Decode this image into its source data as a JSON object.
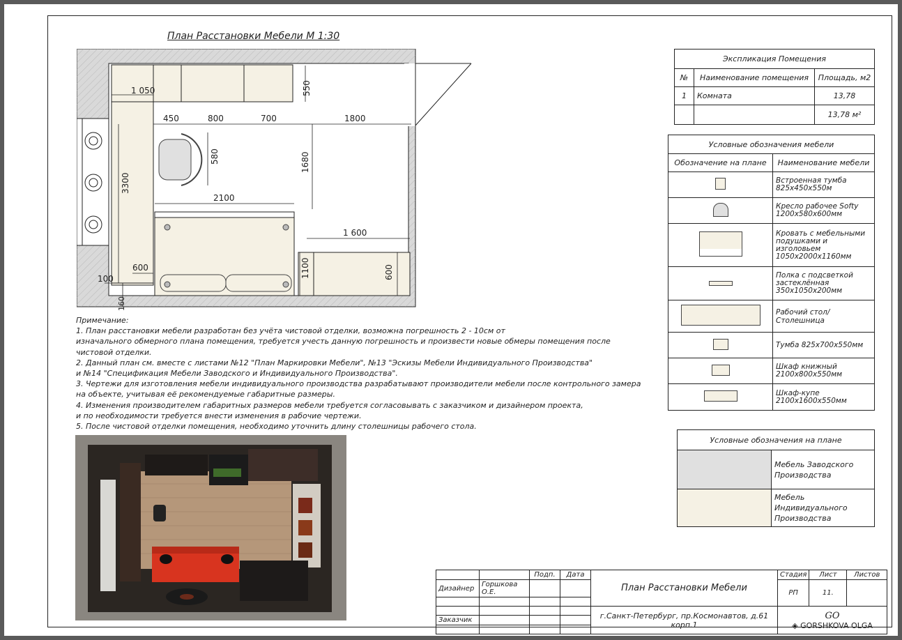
{
  "plan_title": "План Расстановки Мебели    М 1:30",
  "dimensions": {
    "d1050": "1 050",
    "d550": "550",
    "d450": "450",
    "d800": "800",
    "d700": "700",
    "d1800": "1800",
    "d3300": "3300",
    "d580": "580",
    "d1680": "1680",
    "d2100": "2100",
    "d1600": "1 600",
    "d600a": "600",
    "d1100": "1100",
    "d600b": "600",
    "d100": "100",
    "d160": "160"
  },
  "explication": {
    "title": "Экспликация Помещения",
    "col_no": "№",
    "col_name": "Наименование помещения",
    "col_area": "Площадь, м2",
    "rows": [
      {
        "no": "1",
        "name": "Комната",
        "area": "13,78"
      }
    ],
    "total": "13,78 м²"
  },
  "furniture_legend": {
    "title": "Условные обозначения мебели",
    "col_symbol": "Обозначение на плане",
    "col_name": "Наименование мебели",
    "items": [
      {
        "icon": "nightstand-icon",
        "name": "Встроенная тумба 825х450х550м"
      },
      {
        "icon": "armchair-icon",
        "name": "Кресло рабочее Softy 1200х580х600мм"
      },
      {
        "icon": "bed-icon",
        "name": "Кровать с мебельными подушками и изголовьем 1050х2000х1160мм"
      },
      {
        "icon": "shelf-icon",
        "name": "Полка с подсветкой застеклённая 350х1050х200мм"
      },
      {
        "icon": "desk-icon",
        "name": "Рабочий стол/Столешница"
      },
      {
        "icon": "cabinet-icon",
        "name": "Тумба 825х700х550мм"
      },
      {
        "icon": "bookcase-icon",
        "name": "Шкаф книжный 2100х800х550мм"
      },
      {
        "icon": "wardrobe-icon",
        "name": "Шкаф-купе 2100х1600х550мм"
      }
    ]
  },
  "plan_legend": {
    "title": "Условные обозначения на плане",
    "factory": "Мебель Заводского Производства",
    "custom": "Мебель Индивидуального Производства",
    "factory_color": "#e0e0e0",
    "custom_color": "#f5f1e4"
  },
  "notes": {
    "heading": "Примечание:",
    "lines": [
      "1. План расстановки мебели разработан без учёта чистовой отделки, возможна погрешность 2 - 10см от",
      "изначального обмерного плана помещения, требуется учесть данную погрешность и произвести новые обмеры помещения после",
      "чистовой отделки.",
      "2. Данный план см. вместе с листами №12 \"План Маркировки Мебели\", №13 \"Эскизы Мебели Индивидуального Производства\"",
      "и №14 \"Спецификация Мебели Заводского и Индивидуального Производства\".",
      "3. Чертежи для изготовления мебели индивидуального производства разрабатывают производители мебели после контрольного замера",
      "на объекте, учитывая её рекомендуемые габаритные размеры.",
      "4. Изменения производителем габаритных размеров мебели требуется согласовывать с заказчиком и дизайнером проекта,",
      "и по необходимости требуется внести изменения в рабочие чертежи.",
      "5. После чистовой отделки помещения, необходимо уточнить длину столешницы рабочего стола."
    ]
  },
  "stamp": {
    "podp": "Подп.",
    "date": "Дата",
    "designer_label": "Дизайнер",
    "designer_name": "Горшкова О.Е.",
    "client_label": "Заказчик",
    "sheet_title": "План Расстановки Мебели",
    "stage_label": "Стадия",
    "sheet_label": "Лист",
    "sheets_label": "Листов",
    "stage": "РП",
    "sheet": "11.",
    "sheets": "",
    "address": "г.Санкт-Петербург, пр.Космонавтов, д.61 корп.1",
    "logo_mark": "GO",
    "logo_text": "GORSHKOVA OLGA"
  },
  "colors": {
    "wall_gray": "#d9d9d9",
    "custom_furniture": "#f5f1e4",
    "photo_bg": "#2b2622"
  }
}
